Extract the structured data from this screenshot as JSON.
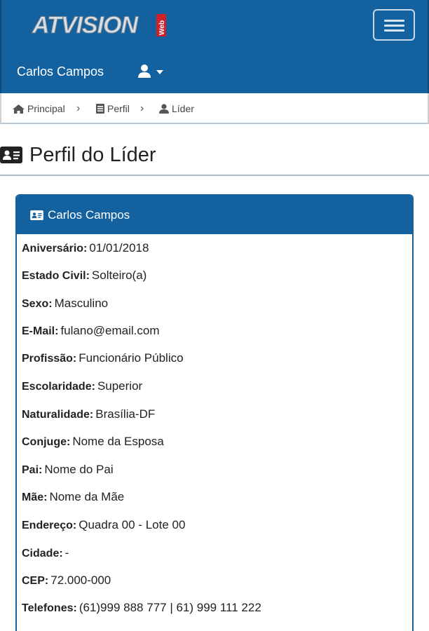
{
  "navbar": {
    "logo_text": "ATVISION",
    "logo_tag": "Web",
    "user_name": "Carlos Campos",
    "colors": {
      "brand": "#13629f",
      "logo_red": "#d0202a"
    }
  },
  "breadcrumb": {
    "items": [
      {
        "label": "Principal",
        "icon": "home-icon"
      },
      {
        "label": "Perfil",
        "icon": "document-icon"
      },
      {
        "label": "Líder",
        "icon": "user-icon"
      }
    ]
  },
  "page": {
    "title": "Perfil do Líder"
  },
  "card": {
    "header": "Carlos Campos",
    "fields": [
      {
        "label": "Aniversário:",
        "value": "01/01/2018"
      },
      {
        "label": "Estado Civil:",
        "value": "Solteiro(a)"
      },
      {
        "label": "Sexo:",
        "value": "Masculino"
      },
      {
        "label": "E-Mail:",
        "value": "fulano@email.com"
      },
      {
        "label": "Profissão:",
        "value": "Funcionário Público"
      },
      {
        "label": "Escolaridade:",
        "value": "Superior"
      },
      {
        "label": "Naturalidade:",
        "value": "Brasília-DF"
      },
      {
        "label": "Conjuge:",
        "value": "Nome da Esposa"
      },
      {
        "label": "Pai:",
        "value": "Nome do Pai"
      },
      {
        "label": "Mãe:",
        "value": "Nome da Mãe"
      },
      {
        "label": "Endereço:",
        "value": "Quadra 00 - Lote 00"
      },
      {
        "label": "Cidade:",
        "value": "-"
      },
      {
        "label": "CEP:",
        "value": "72.000-000"
      },
      {
        "label": "Telefones:",
        "value": "(61)999 888 777 | 61) 999 111 222"
      }
    ]
  }
}
